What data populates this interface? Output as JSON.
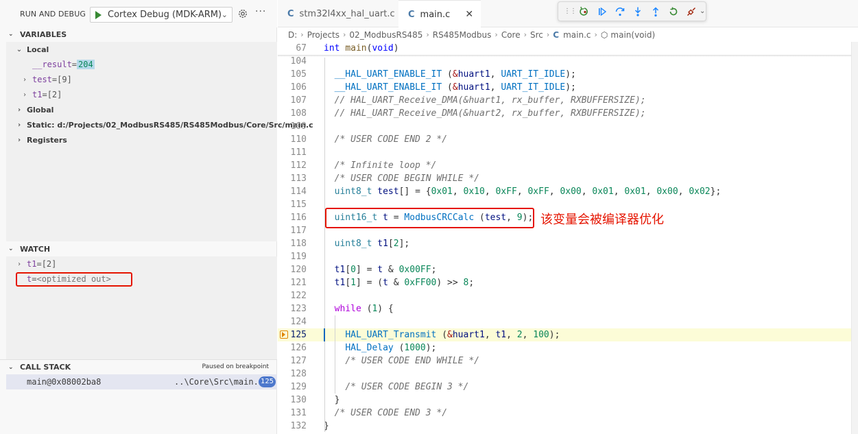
{
  "run_debug": {
    "title": "RUN AND DEBUG",
    "config": "Cortex Debug (MDK-ARM)"
  },
  "variables": {
    "header": "VARIABLES",
    "local_label": "Local",
    "local_items": [
      {
        "name": "__result",
        "eq": " = ",
        "value": "204"
      },
      {
        "name": "test",
        "eq": " = ",
        "value": "[9]"
      },
      {
        "name": "t1",
        "eq": " = ",
        "value": "[2]"
      }
    ],
    "global_label": "Global",
    "static_label": "Static: d:/Projects/02_ModbusRS485/RS485Modbus/Core/Src/main.c",
    "registers_label": "Registers"
  },
  "watch": {
    "header": "WATCH",
    "items": [
      {
        "name": "t1",
        "eq": " = ",
        "value": "[2]"
      },
      {
        "name": "t",
        "eq": " = ",
        "value": "<optimized out>"
      }
    ]
  },
  "call_stack": {
    "header": "CALL STACK",
    "status": "Paused on breakpoint",
    "frame": {
      "func": "main@0x08002ba8",
      "file": "..\\Core\\Src\\main.c",
      "line": "125"
    }
  },
  "tabs": [
    {
      "icon": "C",
      "label": "stm32l4xx_hal_uart.c"
    },
    {
      "icon": "C",
      "label": "main.c"
    }
  ],
  "breadcrumb": [
    "D:",
    "Projects",
    "02_ModbusRS485",
    "RS485Modbus",
    "Core",
    "Src"
  ],
  "breadcrumb_file": "main.c",
  "breadcrumb_symbol": "main(void)",
  "annotation": "该变量会被编译器优化",
  "colors": {
    "accent": "#e51400",
    "badge": "#4d78cc",
    "current_line": "#fcfcd7"
  },
  "code": {
    "sticky": {
      "ln": "67",
      "segs": [
        [
          "kw",
          "int"
        ],
        [
          "pu",
          " "
        ],
        [
          "fn",
          "main"
        ],
        [
          "pu",
          "("
        ],
        [
          "kw",
          "void"
        ],
        [
          "pu",
          ")"
        ]
      ]
    },
    "lines": [
      {
        "ln": "104",
        "segs": []
      },
      {
        "ln": "105",
        "segs": [
          [
            "pu",
            "  "
          ],
          [
            "mac",
            "__HAL_UART_ENABLE_IT"
          ],
          [
            "pu",
            " ("
          ],
          [
            "amp",
            "&"
          ],
          [
            "id",
            "huart1"
          ],
          [
            "pu",
            ", "
          ],
          [
            "mac",
            "UART_IT_IDLE"
          ],
          [
            "pu",
            ");"
          ]
        ]
      },
      {
        "ln": "106",
        "segs": [
          [
            "pu",
            "  "
          ],
          [
            "mac",
            "__HAL_UART_ENABLE_IT"
          ],
          [
            "pu",
            " ("
          ],
          [
            "amp",
            "&"
          ],
          [
            "id",
            "huart1"
          ],
          [
            "pu",
            ", "
          ],
          [
            "mac",
            "UART_IT_IDLE"
          ],
          [
            "pu",
            ");"
          ]
        ]
      },
      {
        "ln": "107",
        "segs": [
          [
            "pu",
            "  "
          ],
          [
            "cm2",
            "// HAL_UART_Receive_DMA(&huart1, rx_buffer, RXBUFFERSIZE);"
          ]
        ]
      },
      {
        "ln": "108",
        "segs": [
          [
            "pu",
            "  "
          ],
          [
            "cm2",
            "// HAL_UART_Receive_DMA(&huart2, rx_buffer, RXBUFFERSIZE);"
          ]
        ]
      },
      {
        "ln": "109",
        "segs": []
      },
      {
        "ln": "110",
        "segs": [
          [
            "pu",
            "  "
          ],
          [
            "cm2",
            "/* USER CODE END 2 */"
          ]
        ]
      },
      {
        "ln": "111",
        "segs": []
      },
      {
        "ln": "112",
        "segs": [
          [
            "pu",
            "  "
          ],
          [
            "cm2",
            "/* Infinite loop */"
          ]
        ]
      },
      {
        "ln": "113",
        "segs": [
          [
            "pu",
            "  "
          ],
          [
            "cm2",
            "/* USER CODE BEGIN WHILE */"
          ]
        ]
      },
      {
        "ln": "114",
        "segs": [
          [
            "pu",
            "  "
          ],
          [
            "ty",
            "uint8_t"
          ],
          [
            "pu",
            " "
          ],
          [
            "id",
            "test"
          ],
          [
            "pu",
            "[] = {"
          ],
          [
            "num",
            "0x01"
          ],
          [
            "pu",
            ", "
          ],
          [
            "num",
            "0x10"
          ],
          [
            "pu",
            ", "
          ],
          [
            "num",
            "0xFF"
          ],
          [
            "pu",
            ", "
          ],
          [
            "num",
            "0xFF"
          ],
          [
            "pu",
            ", "
          ],
          [
            "num",
            "0x00"
          ],
          [
            "pu",
            ", "
          ],
          [
            "num",
            "0x01"
          ],
          [
            "pu",
            ", "
          ],
          [
            "num",
            "0x01"
          ],
          [
            "pu",
            ", "
          ],
          [
            "num",
            "0x00"
          ],
          [
            "pu",
            ", "
          ],
          [
            "num",
            "0x02"
          ],
          [
            "pu",
            "};"
          ]
        ]
      },
      {
        "ln": "115",
        "segs": []
      },
      {
        "ln": "116",
        "segs": [
          [
            "pu",
            "  "
          ],
          [
            "ty",
            "uint16_t"
          ],
          [
            "pu",
            " "
          ],
          [
            "id",
            "t"
          ],
          [
            "pu",
            " = "
          ],
          [
            "fb",
            "ModbusCRCCalc"
          ],
          [
            "pu",
            " ("
          ],
          [
            "id",
            "test"
          ],
          [
            "pu",
            ", "
          ],
          [
            "num",
            "9"
          ],
          [
            "pu",
            ");"
          ]
        ]
      },
      {
        "ln": "117",
        "segs": []
      },
      {
        "ln": "118",
        "segs": [
          [
            "pu",
            "  "
          ],
          [
            "ty",
            "uint8_t"
          ],
          [
            "pu",
            " "
          ],
          [
            "id",
            "t1"
          ],
          [
            "pu",
            "["
          ],
          [
            "num",
            "2"
          ],
          [
            "pu",
            "];"
          ]
        ]
      },
      {
        "ln": "119",
        "segs": []
      },
      {
        "ln": "120",
        "segs": [
          [
            "pu",
            "  "
          ],
          [
            "id",
            "t1"
          ],
          [
            "pu",
            "["
          ],
          [
            "num",
            "0"
          ],
          [
            "pu",
            "] = "
          ],
          [
            "id",
            "t"
          ],
          [
            "pu",
            " & "
          ],
          [
            "num",
            "0x00FF"
          ],
          [
            "pu",
            ";"
          ]
        ]
      },
      {
        "ln": "121",
        "segs": [
          [
            "pu",
            "  "
          ],
          [
            "id",
            "t1"
          ],
          [
            "pu",
            "["
          ],
          [
            "num",
            "1"
          ],
          [
            "pu",
            "] = ("
          ],
          [
            "id",
            "t"
          ],
          [
            "pu",
            " & "
          ],
          [
            "num",
            "0xFF00"
          ],
          [
            "pu",
            ") >> "
          ],
          [
            "num",
            "8"
          ],
          [
            "pu",
            ";"
          ]
        ]
      },
      {
        "ln": "122",
        "segs": []
      },
      {
        "ln": "123",
        "segs": [
          [
            "pu",
            "  "
          ],
          [
            "kw2",
            "while"
          ],
          [
            "pu",
            " ("
          ],
          [
            "num",
            "1"
          ],
          [
            "pu",
            ") {"
          ]
        ]
      },
      {
        "ln": "124",
        "segs": []
      },
      {
        "ln": "125",
        "segs": [
          [
            "pu",
            "    "
          ],
          [
            "fb",
            "HAL_UART_Transmit"
          ],
          [
            "pu",
            " ("
          ],
          [
            "amp",
            "&"
          ],
          [
            "id",
            "huart1"
          ],
          [
            "pu",
            ", "
          ],
          [
            "id",
            "t1"
          ],
          [
            "pu",
            ", "
          ],
          [
            "num",
            "2"
          ],
          [
            "pu",
            ", "
          ],
          [
            "num",
            "100"
          ],
          [
            "pu",
            ");"
          ]
        ]
      },
      {
        "ln": "126",
        "segs": [
          [
            "pu",
            "    "
          ],
          [
            "fb",
            "HAL_Delay"
          ],
          [
            "pu",
            " ("
          ],
          [
            "num",
            "1000"
          ],
          [
            "pu",
            ");"
          ]
        ]
      },
      {
        "ln": "127",
        "segs": [
          [
            "pu",
            "    "
          ],
          [
            "cm2",
            "/* USER CODE END WHILE */"
          ]
        ]
      },
      {
        "ln": "128",
        "segs": []
      },
      {
        "ln": "129",
        "segs": [
          [
            "pu",
            "    "
          ],
          [
            "cm2",
            "/* USER CODE BEGIN 3 */"
          ]
        ]
      },
      {
        "ln": "130",
        "segs": [
          [
            "pu",
            "  }"
          ]
        ]
      },
      {
        "ln": "131",
        "segs": [
          [
            "pu",
            "  "
          ],
          [
            "cm2",
            "/* USER CODE END 3 */"
          ]
        ]
      },
      {
        "ln": "132",
        "segs": [
          [
            "pu",
            "}"
          ]
        ]
      }
    ],
    "current_line": "125"
  }
}
